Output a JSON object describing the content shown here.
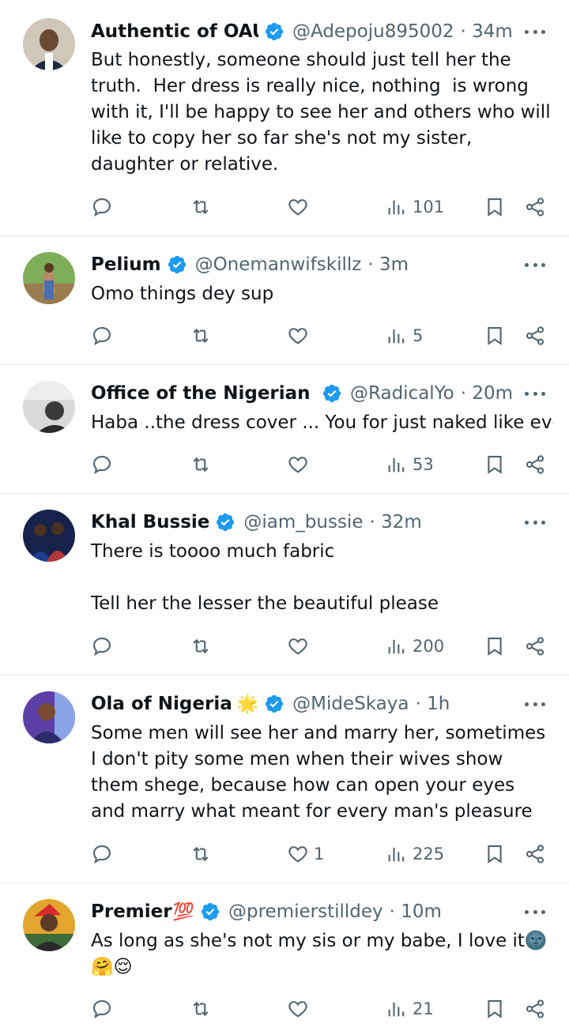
{
  "tweets": [
    {
      "name": "Authentic of OAU",
      "name_emoji": "",
      "handle": "@Adepoju895002",
      "time": "· 34m",
      "text": "But honestly, someone should just tell her the truth.  Her dress is really nice, nothing  is wrong with it, I'll be happy to see her and others who will like to copy her so far she's not my sister, daughter or relative.",
      "likes": "",
      "views": "101",
      "avatar_colors": [
        "#cfc8b9",
        "#6b4a33"
      ]
    },
    {
      "name": "Pelium",
      "name_emoji": "",
      "handle": "@Onemanwifskillz",
      "time": "· 3m",
      "text": "Omo things dey sup",
      "likes": "",
      "views": "5",
      "avatar_colors": [
        "#7fae59",
        "#b98a6a"
      ]
    },
    {
      "name": "Office of the Nigerian Cit",
      "name_emoji": "",
      "handle": "@RadicalYo",
      "time": "· 20m",
      "text": "Haba ..the dress cover ... You for just naked like eve",
      "likes": "",
      "views": "53",
      "avatar_colors": [
        "#d9d9d9",
        "#3b3b3b"
      ]
    },
    {
      "name": "Khal Bussie",
      "name_emoji": "",
      "handle": "@iam_bussie",
      "time": "· 32m",
      "text": "There is toooo much fabric\n\nTell her the lesser the beautiful please",
      "likes": "",
      "views": "200",
      "avatar_colors": [
        "#16224a",
        "#b0383b"
      ]
    },
    {
      "name": "Ola of Nigeria",
      "name_emoji": "🌟",
      "handle": "@MideSkaya",
      "time": "· 1h",
      "text": "Some men will see her and marry her, sometimes I don't pity some men when their wives show them shege, because how can open your eyes and marry what meant for every man's pleasure",
      "likes": "1",
      "views": "225",
      "avatar_colors": [
        "#5e3fa8",
        "#7a4b33"
      ]
    },
    {
      "name": "Premier",
      "name_emoji": "💯",
      "handle": "@premierstilldey",
      "time": "· 10m",
      "text": "As long as she's not my sis or my babe, I love it🌚\n🤗😌",
      "likes": "",
      "views": "21",
      "avatar_colors": [
        "#e3a52e",
        "#5a3a26"
      ]
    }
  ],
  "colors": {
    "text": "#0f1419",
    "muted": "#536471",
    "verified": "#1d9bf0",
    "divider": "#e6e9ec"
  },
  "icons": {
    "reply": "reply-icon",
    "retweet": "retweet-icon",
    "like": "heart-icon",
    "views": "views-icon",
    "bookmark": "bookmark-icon",
    "share": "share-icon",
    "more": "more-icon",
    "verified": "verified-badge-icon"
  }
}
